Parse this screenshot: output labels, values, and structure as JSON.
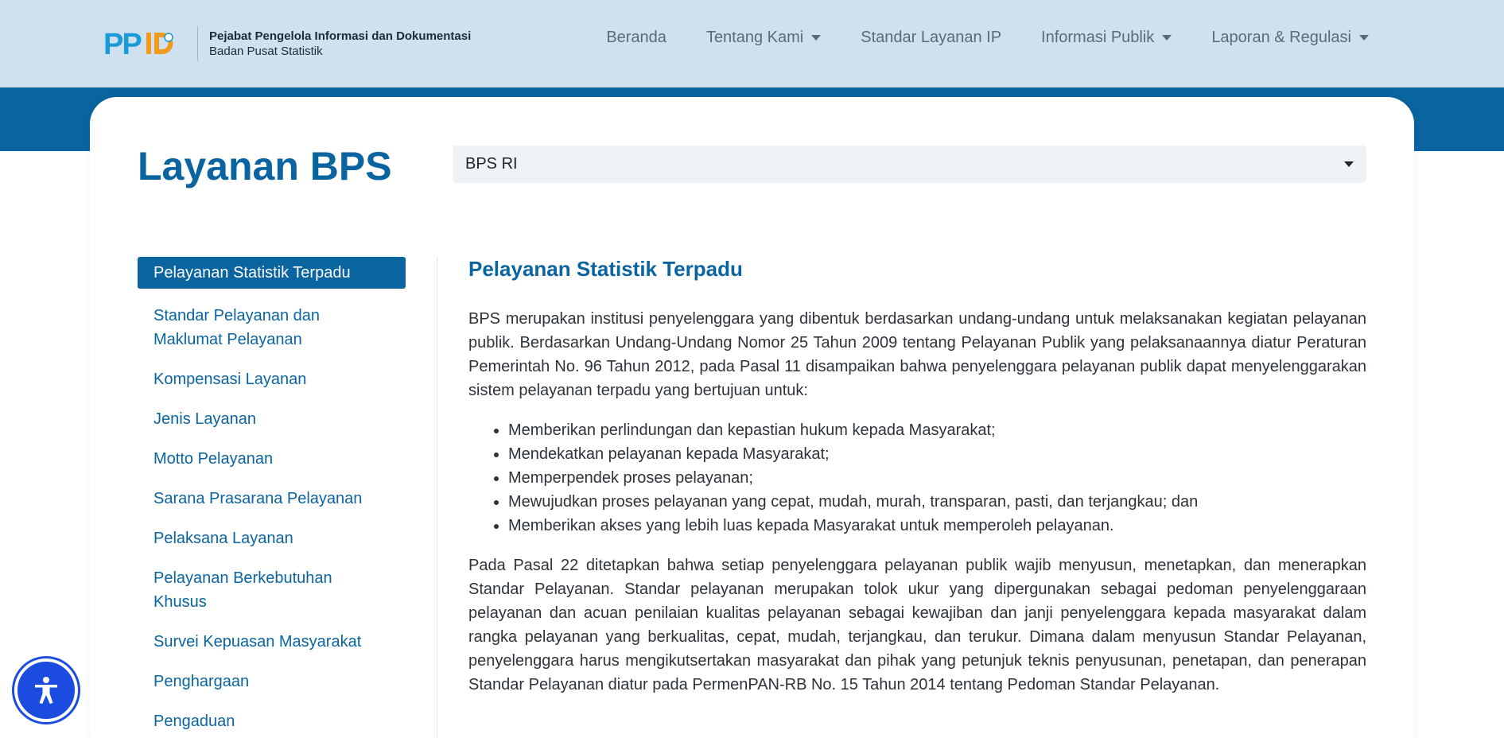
{
  "header": {
    "logo_text": "PPID",
    "org_line1": "Pejabat Pengelola Informasi dan Dokumentasi",
    "org_line2": "Badan Pusat Statistik",
    "nav": [
      {
        "label": "Beranda",
        "dropdown": false
      },
      {
        "label": "Tentang Kami",
        "dropdown": true
      },
      {
        "label": "Standar Layanan IP",
        "dropdown": false
      },
      {
        "label": "Informasi Publik",
        "dropdown": true
      },
      {
        "label": "Laporan & Regulasi",
        "dropdown": true
      }
    ]
  },
  "page": {
    "title": "Layanan BPS",
    "select_value": "BPS RI"
  },
  "sidebar": {
    "items": [
      {
        "label": "Pelayanan Statistik Terpadu",
        "active": true
      },
      {
        "label": "Standar Pelayanan dan\nMaklumat Pelayanan",
        "active": false
      },
      {
        "label": "Kompensasi Layanan",
        "active": false
      },
      {
        "label": "Jenis Layanan",
        "active": false
      },
      {
        "label": "Motto Pelayanan",
        "active": false
      },
      {
        "label": "Sarana Prasarana Pelayanan",
        "active": false
      },
      {
        "label": "Pelaksana Layanan",
        "active": false
      },
      {
        "label": "Pelayanan Berkebutuhan\nKhusus",
        "active": false
      },
      {
        "label": "Survei Kepuasan Masyarakat",
        "active": false
      },
      {
        "label": "Penghargaan",
        "active": false
      },
      {
        "label": "Pengaduan",
        "active": false
      }
    ]
  },
  "content": {
    "heading": "Pelayanan Statistik Terpadu",
    "para1": "BPS merupakan institusi penyelenggara yang dibentuk berdasarkan undang-undang untuk melaksanakan kegiatan pelayanan publik. Berdasarkan Undang-Undang Nomor 25 Tahun 2009 tentang Pelayanan Publik yang pelaksanaannya diatur Peraturan Pemerintah No. 96 Tahun 2012, pada Pasal 11 disampaikan bahwa penyelenggara pelayanan publik dapat menyelenggarakan sistem pelayanan terpadu yang bertujuan untuk:",
    "bullets": [
      "Memberikan perlindungan dan kepastian hukum kepada Masyarakat;",
      "Mendekatkan pelayanan kepada Masyarakat;",
      "Memperpendek proses pelayanan;",
      "Mewujudkan proses pelayanan yang cepat, mudah, murah, transparan, pasti, dan terjangkau; dan",
      "Memberikan akses yang lebih luas kepada Masyarakat untuk memperoleh pelayanan."
    ],
    "para2": "Pada Pasal 22 ditetapkan bahwa setiap penyelenggara pelayanan publik wajib menyusun, menetapkan, dan menerapkan Standar Pelayanan. Standar pelayanan merupakan tolok ukur yang dipergunakan sebagai pedoman penyelenggaraan pelayanan dan acuan penilaian kualitas pelayanan sebagai kewajiban dan janji penyelenggara kepada masyarakat dalam rangka pelayanan yang berkualitas, cepat, mudah, terjangkau, dan terukur. Dimana dalam menyusun Standar Pelayanan, penyelenggara harus mengikutsertakan masyarakat dan pihak yang petunjuk teknis penyusunan, penetapan, dan penerapan Standar Pelayanan diatur pada PermenPAN-RB No. 15 Tahun 2014 tentang Pedoman Standar Pelayanan."
  },
  "accessibility": {
    "icon": "accessibility-icon"
  },
  "colors": {
    "topbar": "#cfe1ee",
    "primary": "#0a64a0",
    "logo_blue": "#1a9ad6",
    "logo_orange": "#f29a1d",
    "a11y": "#1c4be0"
  }
}
